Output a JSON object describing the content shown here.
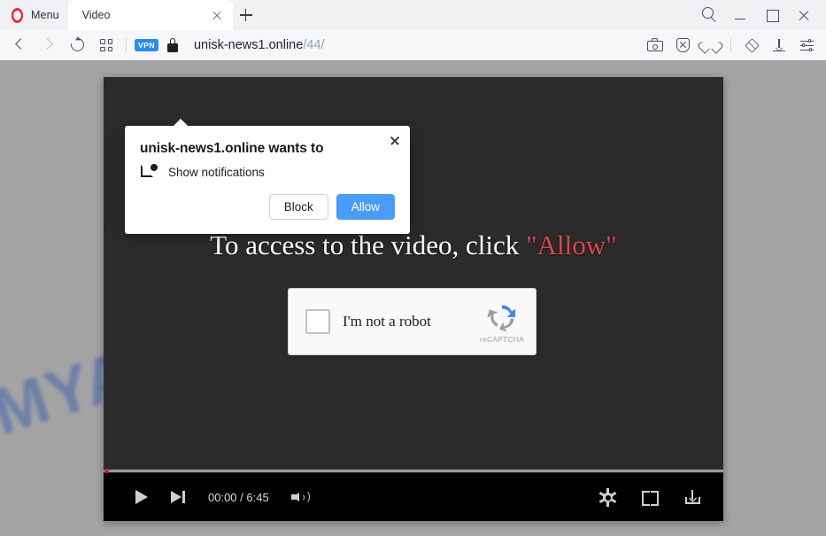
{
  "browser": {
    "menu_label": "Menu",
    "menu_icon": "opera-logo-icon",
    "tab": {
      "title": "Video",
      "close_icon": "close-icon"
    },
    "new_tab_icon": "plus-icon",
    "window_controls": [
      {
        "name": "search-icon",
        "label": "Search"
      },
      {
        "name": "minimize-icon",
        "label": "Minimize"
      },
      {
        "name": "maximize-icon",
        "label": "Maximize"
      },
      {
        "name": "close-window-icon",
        "label": "Close"
      }
    ],
    "nav": {
      "back_icon": "back-arrow-icon",
      "forward_icon": "forward-arrow-icon",
      "reload_icon": "reload-icon",
      "tabs_overview_icon": "grid-icon",
      "vpn_badge": "VPN",
      "lock_icon": "lock-icon",
      "url_host": "unisk-news1.online",
      "url_path": "/44/"
    },
    "nav_right_icons": [
      {
        "name": "snapshot-icon",
        "label": "Snapshot"
      },
      {
        "name": "ad-blocker-icon",
        "label": "Ad blocker"
      },
      {
        "name": "heart-icon",
        "label": "Add to favorites"
      },
      {
        "name": "cube-icon",
        "label": "Extensions"
      },
      {
        "name": "download-icon",
        "label": "Downloads"
      },
      {
        "name": "settings-sliders-icon",
        "label": "Easy setup"
      }
    ]
  },
  "page": {
    "watermark": "MYANTISPYWARE.COM",
    "watermark_color": "#3f63ad",
    "headline_main": "To access to the video, click ",
    "headline_keyword": "\"Allow\"",
    "headline_keyword_color": "#e0434c",
    "recaptcha": {
      "checkbox_name": "recaptcha-checkbox",
      "label": "I'm not a robot",
      "brand": "reCAPTCHA",
      "logo_icon": "recaptcha-logo-icon"
    },
    "player": {
      "play_icon": "play-icon",
      "next_icon": "next-track-icon",
      "time": "00:00 / 6:45",
      "volume_icon": "volume-icon",
      "settings_icon": "gear-icon",
      "fullscreen_icon": "fullscreen-icon",
      "download_icon": "download-icon",
      "progress_percent": 0
    },
    "cursor_icon": "mouse-cursor-icon"
  },
  "permission_dialog": {
    "title": "unisk-news1.online wants to",
    "permission_icon": "notification-bell-icon",
    "permission_text": "Show notifications",
    "close_icon": "close-icon",
    "block_label": "Block",
    "allow_label": "Allow",
    "allow_color": "#4a9cf6"
  }
}
